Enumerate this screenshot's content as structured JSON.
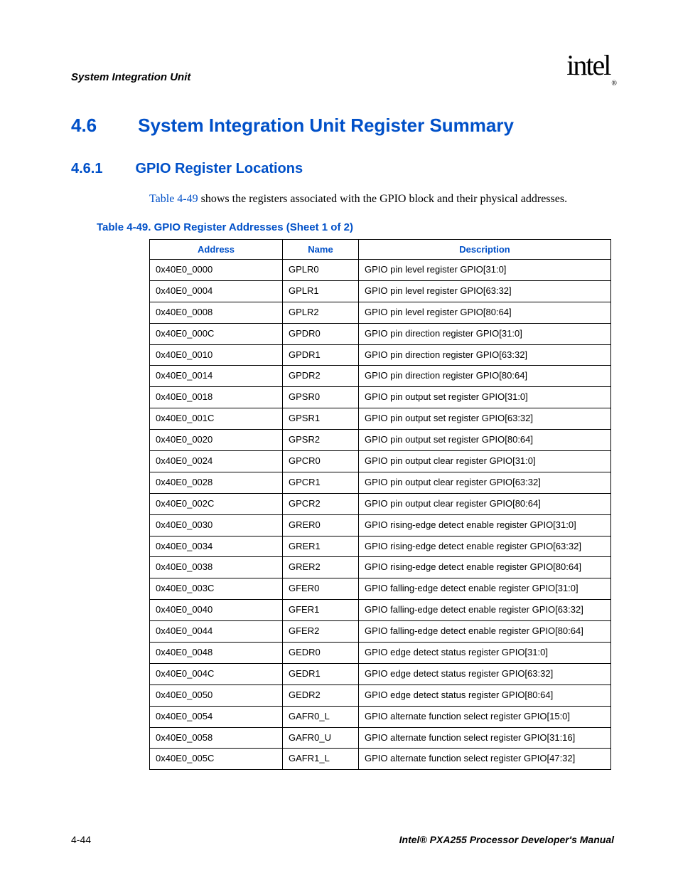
{
  "header": {
    "section": "System Integration Unit",
    "logo_text": "intel",
    "logo_mark": "®"
  },
  "h1": {
    "num": "4.6",
    "text": "System Integration Unit Register Summary"
  },
  "h2": {
    "num": "4.6.1",
    "text": "GPIO Register Locations"
  },
  "intro": {
    "link": "Table 4-49",
    "rest": " shows the registers associated with the GPIO block and their physical addresses."
  },
  "table": {
    "caption": "Table 4-49. GPIO Register Addresses (Sheet 1 of 2)",
    "headers": {
      "address": "Address",
      "name": "Name",
      "description": "Description"
    },
    "rows": [
      {
        "address": "0x40E0_0000",
        "name": "GPLR0",
        "description": "GPIO pin level register GPIO[31:0]"
      },
      {
        "address": "0x40E0_0004",
        "name": "GPLR1",
        "description": "GPIO pin level register GPIO[63:32]"
      },
      {
        "address": "0x40E0_0008",
        "name": "GPLR2",
        "description": "GPIO pin level register GPIO[80:64]"
      },
      {
        "address": "0x40E0_000C",
        "name": "GPDR0",
        "description": "GPIO pin direction register GPIO[31:0]"
      },
      {
        "address": "0x40E0_0010",
        "name": "GPDR1",
        "description": "GPIO pin direction register GPIO[63:32]"
      },
      {
        "address": "0x40E0_0014",
        "name": "GPDR2",
        "description": "GPIO pin direction register GPIO[80:64]"
      },
      {
        "address": "0x40E0_0018",
        "name": "GPSR0",
        "description": "GPIO pin output set register GPIO[31:0]"
      },
      {
        "address": "0x40E0_001C",
        "name": "GPSR1",
        "description": "GPIO pin output set register GPIO[63:32]"
      },
      {
        "address": "0x40E0_0020",
        "name": "GPSR2",
        "description": "GPIO pin output set register GPIO[80:64]"
      },
      {
        "address": "0x40E0_0024",
        "name": "GPCR0",
        "description": "GPIO pin output clear register GPIO[31:0]"
      },
      {
        "address": "0x40E0_0028",
        "name": "GPCR1",
        "description": "GPIO pin output clear register GPIO[63:32]"
      },
      {
        "address": "0x40E0_002C",
        "name": "GPCR2",
        "description": "GPIO pin output clear register GPIO[80:64]"
      },
      {
        "address": "0x40E0_0030",
        "name": "GRER0",
        "description": "GPIO rising-edge detect enable register GPIO[31:0]"
      },
      {
        "address": "0x40E0_0034",
        "name": "GRER1",
        "description": "GPIO rising-edge detect enable register GPIO[63:32]"
      },
      {
        "address": "0x40E0_0038",
        "name": "GRER2",
        "description": "GPIO rising-edge detect enable register GPIO[80:64]"
      },
      {
        "address": "0x40E0_003C",
        "name": "GFER0",
        "description": "GPIO falling-edge detect enable register GPIO[31:0]"
      },
      {
        "address": "0x40E0_0040",
        "name": "GFER1",
        "description": "GPIO falling-edge detect enable register GPIO[63:32]"
      },
      {
        "address": "0x40E0_0044",
        "name": "GFER2",
        "description": "GPIO falling-edge detect enable register GPIO[80:64]"
      },
      {
        "address": "0x40E0_0048",
        "name": "GEDR0",
        "description": "GPIO edge detect status register GPIO[31:0]"
      },
      {
        "address": "0x40E0_004C",
        "name": "GEDR1",
        "description": "GPIO edge detect status register GPIO[63:32]"
      },
      {
        "address": "0x40E0_0050",
        "name": "GEDR2",
        "description": "GPIO edge detect status register GPIO[80:64]"
      },
      {
        "address": "0x40E0_0054",
        "name": "GAFR0_L",
        "description": "GPIO alternate function select register GPIO[15:0]"
      },
      {
        "address": "0x40E0_0058",
        "name": "GAFR0_U",
        "description": "GPIO alternate function select register GPIO[31:16]"
      },
      {
        "address": "0x40E0_005C",
        "name": "GAFR1_L",
        "description": "GPIO alternate function select register GPIO[47:32]"
      }
    ]
  },
  "footer": {
    "page": "4-44",
    "doc": "Intel® PXA255 Processor Developer's Manual"
  }
}
